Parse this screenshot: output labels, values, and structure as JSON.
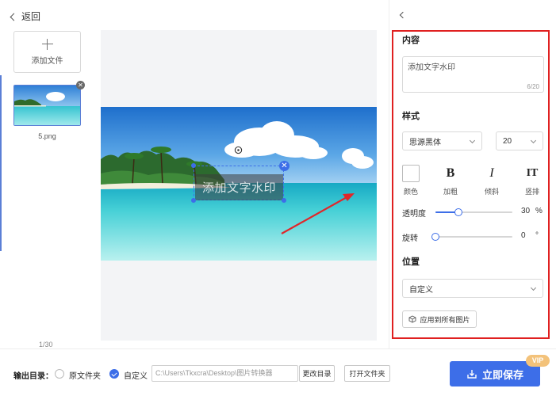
{
  "header": {
    "back_label": "返回"
  },
  "sidebar": {
    "add_file_label": "添加文件",
    "files": [
      {
        "name": "5.png"
      }
    ],
    "page_counter": "1/30"
  },
  "canvas": {
    "watermark_text": "添加文字水印"
  },
  "panel": {
    "content": {
      "title": "内容",
      "text": "添加文字水印",
      "char_count": "6/20"
    },
    "style": {
      "title": "样式",
      "font_family": "思源黑体",
      "font_size": "20",
      "tools": {
        "color": "颜色",
        "bold": "加粗",
        "italic": "倾斜",
        "vertical": "竖排"
      },
      "bold_glyph": "B",
      "italic_glyph": "I",
      "vertical_glyph": "IT",
      "opacity": {
        "label": "透明度",
        "value": "30",
        "unit": "%",
        "fraction": 0.3
      },
      "rotation": {
        "label": "旋转",
        "value": "0",
        "unit": "°",
        "fraction": 0.0
      }
    },
    "position": {
      "title": "位置",
      "value": "自定义",
      "apply_all_label": "应用到所有图片"
    }
  },
  "footer": {
    "output_label": "输出目录：",
    "option_original": "原文件夹",
    "option_custom": "自定义",
    "selected": "custom",
    "path": "C:\\Users\\Tkxcra\\Desktop\\图片转换器",
    "change_dir_label": "更改目录",
    "open_folder_label": "打开文件夹",
    "save_label": "立即保存",
    "vip_badge": "VIP"
  },
  "colors": {
    "accent": "#3d6ee8",
    "highlight_border": "#e02020",
    "vip": "#f3c27a",
    "arrow": "#e0262a"
  }
}
